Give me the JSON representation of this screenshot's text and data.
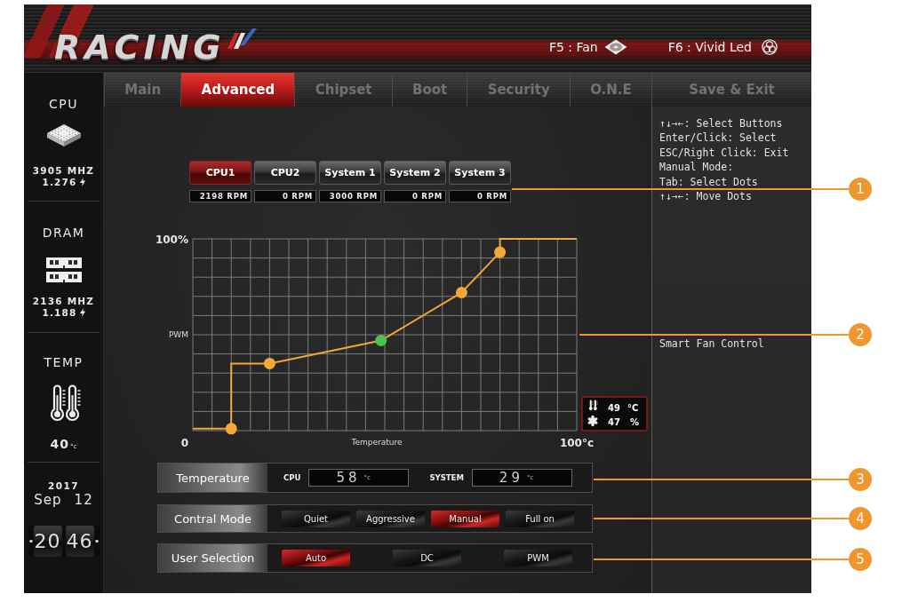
{
  "header": {
    "logo": "RACING",
    "hotkeys": [
      {
        "label": "F5 : Fan",
        "kind": "fan"
      },
      {
        "label": "F6 : Vivid Led",
        "kind": "led"
      }
    ]
  },
  "tabs": [
    {
      "label": "Main",
      "selected": false
    },
    {
      "label": "Advanced",
      "selected": true
    },
    {
      "label": "Chipset",
      "selected": false
    },
    {
      "label": "Boot",
      "selected": false
    },
    {
      "label": "Security",
      "selected": false
    },
    {
      "label": "O.N.E",
      "selected": false
    },
    {
      "label": "Save & Exit",
      "selected": false
    }
  ],
  "sidebar": {
    "sections": [
      {
        "title": "CPU",
        "kind": "cpu",
        "frequency": "3905 MHZ",
        "voltage": "1.276"
      },
      {
        "title": "DRAM",
        "kind": "dram",
        "frequency": "2136 MHZ",
        "voltage": "1.188"
      },
      {
        "title": "TEMP",
        "kind": "temp",
        "value": "40",
        "unit": "°c"
      }
    ],
    "date": {
      "year": "2017",
      "month": "Sep",
      "day": "12"
    },
    "clock": {
      "hours": "20",
      "minutes": "46"
    }
  },
  "fan_tabs": [
    {
      "label": "CPU1",
      "selected": true,
      "rpm": "2198 RPM"
    },
    {
      "label": "CPU2",
      "selected": false,
      "rpm": "0 RPM"
    },
    {
      "label": "System 1",
      "selected": false,
      "rpm": "3000 RPM"
    },
    {
      "label": "System 2",
      "selected": false,
      "rpm": "0 RPM"
    },
    {
      "label": "System 3",
      "selected": false,
      "rpm": "0 RPM"
    }
  ],
  "fan_curve": {
    "axis_labels": {
      "y_max": "100%",
      "y": "PWM",
      "origin": "0",
      "x": "Temperature",
      "x_max": "100°c"
    },
    "readout": {
      "temperature": "49",
      "temperature_unit": "°C",
      "duty": "47",
      "duty_unit": "%"
    }
  },
  "temperature": {
    "label": "Temperature",
    "readings": [
      {
        "label": "CPU",
        "value": "58",
        "unit": "°c"
      },
      {
        "label": "SYSTEM",
        "value": "29",
        "unit": "°c"
      }
    ]
  },
  "control_mode": {
    "label": "Contral Mode",
    "options": [
      {
        "label": "Quiet",
        "selected": false
      },
      {
        "label": "Aggressive",
        "selected": false
      },
      {
        "label": "Manual",
        "selected": true
      },
      {
        "label": "Full on",
        "selected": false
      }
    ]
  },
  "user_selection": {
    "label": "User Selection",
    "options": [
      {
        "label": "Auto",
        "selected": true
      },
      {
        "label": "DC",
        "selected": false
      },
      {
        "label": "PWM",
        "selected": false
      }
    ]
  },
  "help": {
    "lines": [
      "↑↓→←: Select Buttons",
      "Enter/Click: Select",
      "ESC/Right Click: Exit",
      "Manual Mode:",
      "Tab: Select Dots",
      "↑↓→←: Move Dots"
    ],
    "description": "Smart Fan Control"
  },
  "callouts": [
    {
      "number": "1"
    },
    {
      "number": "2"
    },
    {
      "number": "3"
    },
    {
      "number": "4"
    },
    {
      "number": "5"
    }
  ]
}
